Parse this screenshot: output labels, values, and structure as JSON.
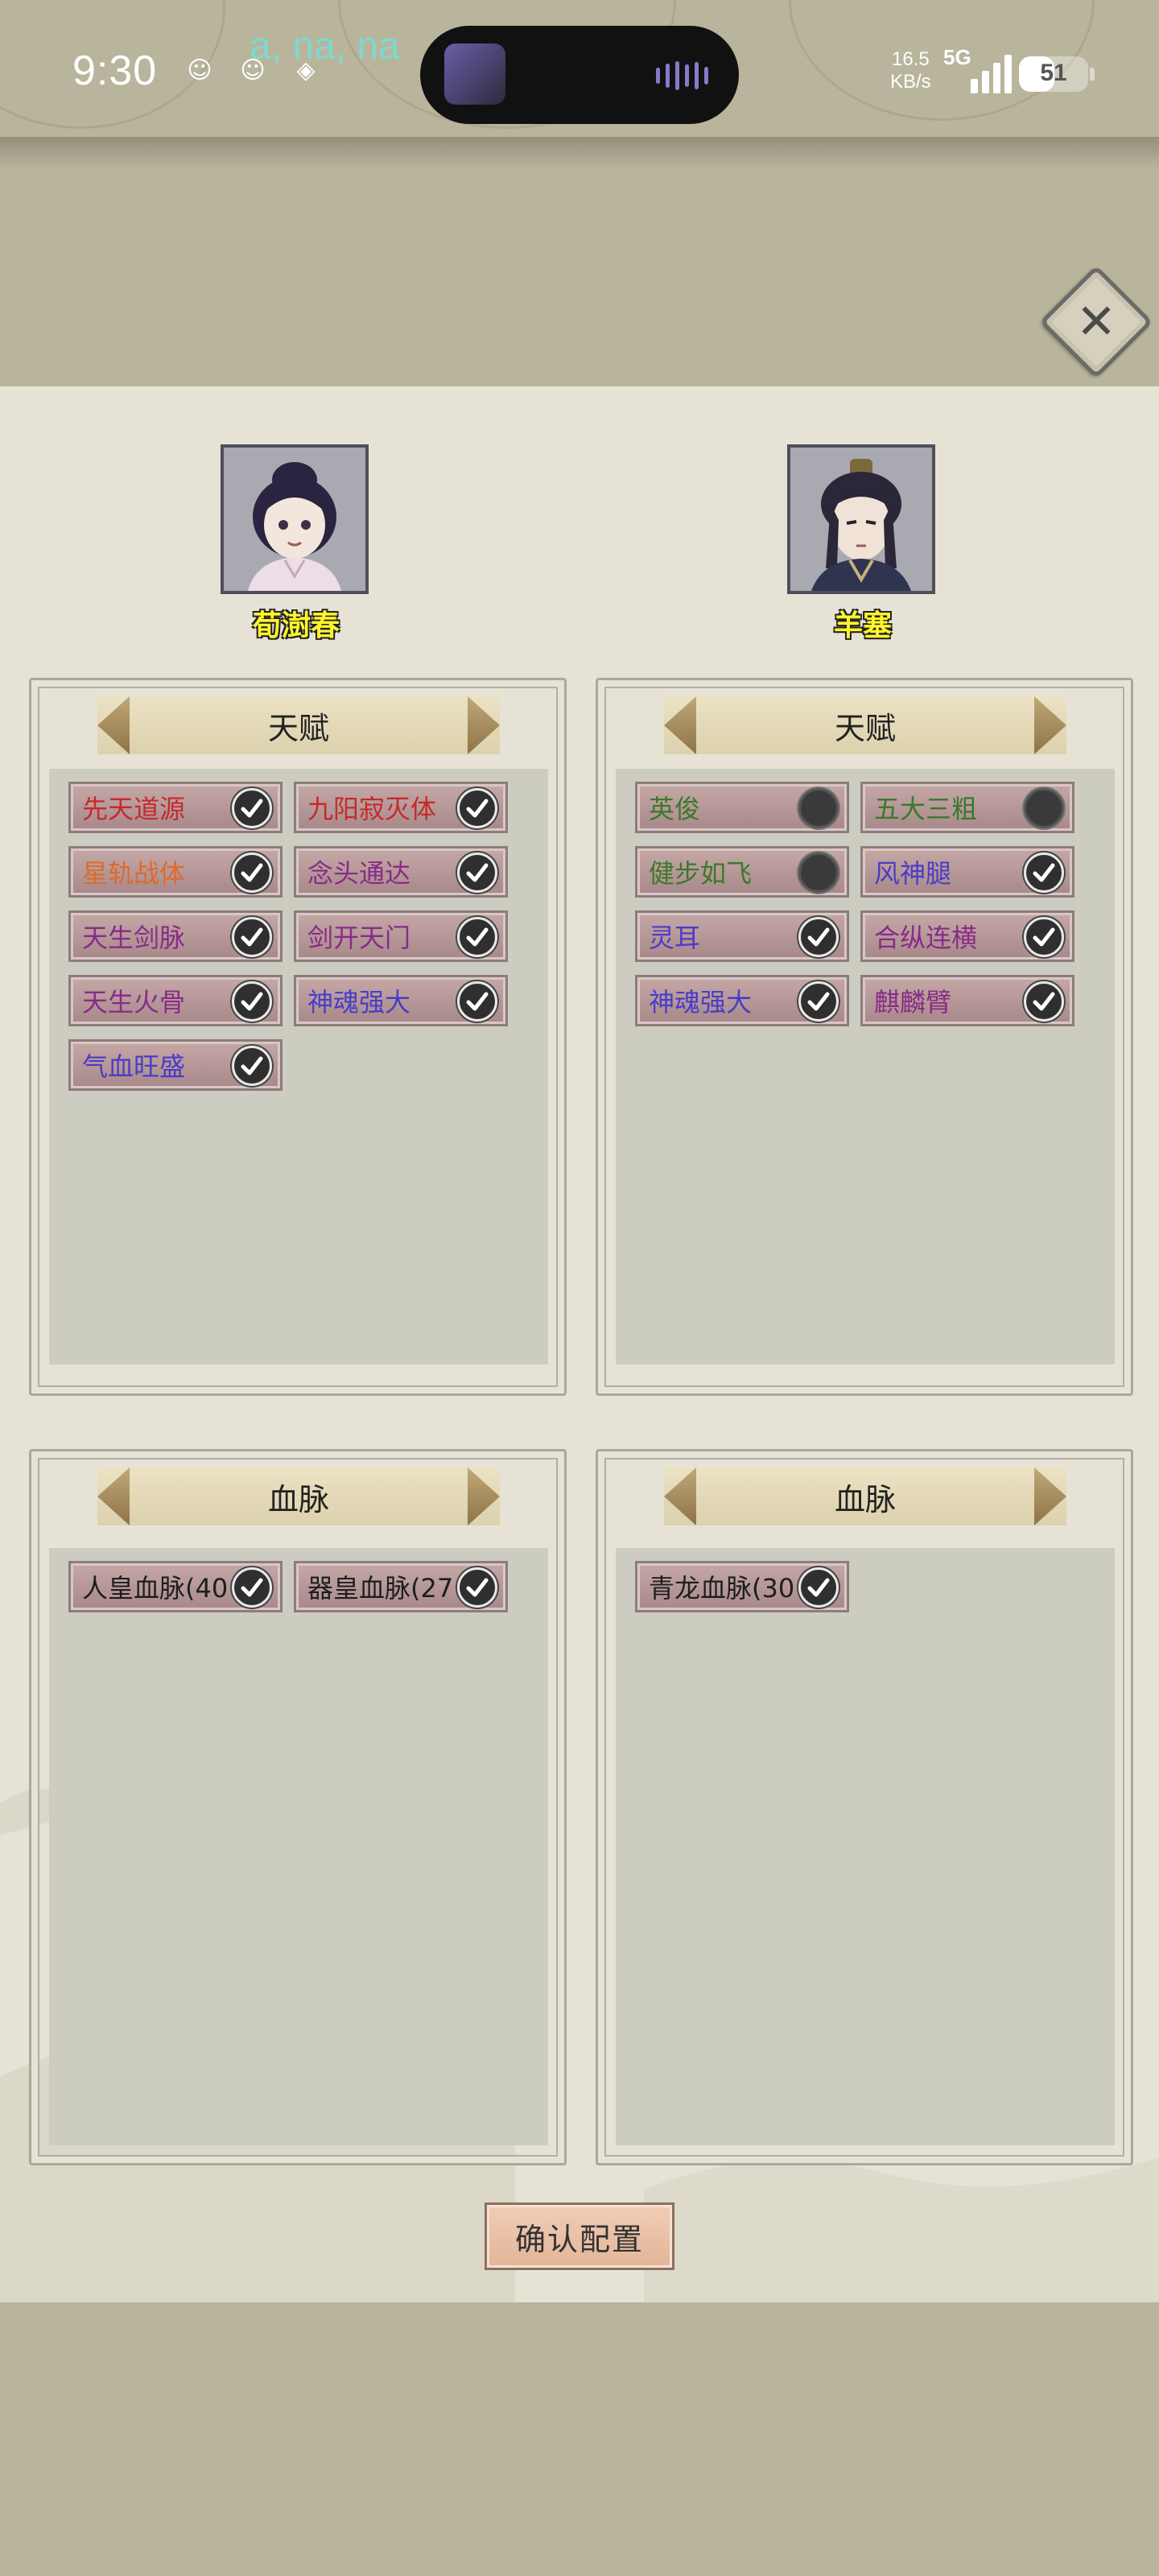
{
  "status_bar": {
    "time": "9:30",
    "media_text": "a, na, na",
    "speed_value": "16.5",
    "speed_unit": "KB/s",
    "network": "5G",
    "battery": "51",
    "battery_level": 0.51
  },
  "characters": [
    {
      "name": "荀澍春"
    },
    {
      "name": "羊塞"
    }
  ],
  "talent_sections": [
    {
      "title": "天赋",
      "tags": [
        {
          "label": "先天道源",
          "color": "#c62a2a",
          "checked": true
        },
        {
          "label": "九阳寂灭体",
          "color": "#c62a2a",
          "checked": true
        },
        {
          "label": "星轨战体",
          "color": "#e0692a",
          "checked": true
        },
        {
          "label": "念头通达",
          "color": "#8a2a8a",
          "checked": true
        },
        {
          "label": "天生剑脉",
          "color": "#8a2a8a",
          "checked": true
        },
        {
          "label": "剑开天门",
          "color": "#8a2a8a",
          "checked": true
        },
        {
          "label": "天生火骨",
          "color": "#8a2a8a",
          "checked": true
        },
        {
          "label": "神魂强大",
          "color": "#4a3cc8",
          "checked": true
        },
        {
          "label": "气血旺盛",
          "color": "#4a3cc8",
          "checked": true
        }
      ]
    },
    {
      "title": "天赋",
      "tags": [
        {
          "label": "英俊",
          "color": "#3a7a2a",
          "checked": false
        },
        {
          "label": "五大三粗",
          "color": "#3a7a2a",
          "checked": false
        },
        {
          "label": "健步如飞",
          "color": "#3a7a2a",
          "checked": false
        },
        {
          "label": "风神腿",
          "color": "#4a3cc8",
          "checked": true
        },
        {
          "label": "灵耳",
          "color": "#4a3cc8",
          "checked": true
        },
        {
          "label": "合纵连横",
          "color": "#8a2a8a",
          "checked": true
        },
        {
          "label": "神魂强大",
          "color": "#4a3cc8",
          "checked": true
        },
        {
          "label": "麒麟臂",
          "color": "#8a2a8a",
          "checked": true
        }
      ]
    }
  ],
  "bloodline_sections": [
    {
      "title": "血脉",
      "tags": [
        {
          "label": "人皇血脉(40",
          "color": "#1e1e1e",
          "checked": true
        },
        {
          "label": "器皇血脉(27",
          "color": "#1e1e1e",
          "checked": true
        }
      ]
    },
    {
      "title": "血脉",
      "tags": [
        {
          "label": "青龙血脉(30",
          "color": "#1e1e1e",
          "checked": true
        }
      ]
    }
  ],
  "confirm_label": "确认配置"
}
